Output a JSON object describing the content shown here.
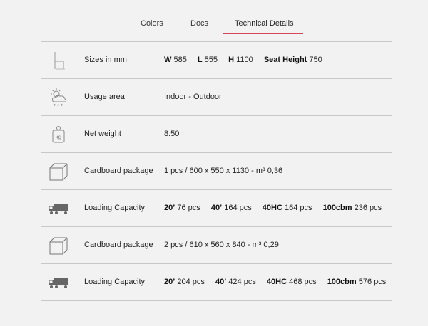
{
  "tabs": [
    {
      "label": "Colors"
    },
    {
      "label": "Docs"
    },
    {
      "label": "Technical Details",
      "active": true
    }
  ],
  "accent_color": "#d9455a",
  "rows": [
    {
      "icon": "chair-icon",
      "label": "Sizes in mm",
      "segments": [
        {
          "key": "W",
          "val": "585"
        },
        {
          "key": "L",
          "val": "555"
        },
        {
          "key": "H",
          "val": "1100"
        },
        {
          "key": "Seat Height",
          "val": "750"
        }
      ]
    },
    {
      "icon": "weather-cloud-sun-icon",
      "label": "Usage area",
      "value": "Indoor - Outdoor"
    },
    {
      "icon": "weight-icon",
      "label": "Net weight",
      "value": "8.50",
      "icon_text": "kg"
    },
    {
      "icon": "box-icon",
      "label": "Cardboard package",
      "value": "1 pcs / 600 x 550 x 1130 - m³ 0,36"
    },
    {
      "icon": "truck-icon",
      "label": "Loading Capacity",
      "segments": [
        {
          "key": "20’",
          "val": "76 pcs"
        },
        {
          "key": "40’",
          "val": "164 pcs"
        },
        {
          "key": "40HC",
          "val": "164 pcs"
        },
        {
          "key": "100cbm",
          "val": "236 pcs"
        }
      ]
    },
    {
      "icon": "box-icon",
      "label": "Cardboard package",
      "value": "2 pcs / 610 x 560 x 840 - m³ 0,29"
    },
    {
      "icon": "truck-icon",
      "label": "Loading Capacity",
      "segments": [
        {
          "key": "20’",
          "val": "204 pcs"
        },
        {
          "key": "40’",
          "val": "424 pcs"
        },
        {
          "key": "40HC",
          "val": "468 pcs"
        },
        {
          "key": "100cbm",
          "val": "576 pcs"
        }
      ]
    }
  ]
}
